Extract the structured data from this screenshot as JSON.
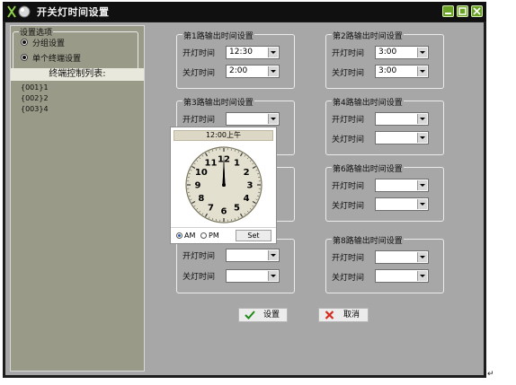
{
  "window": {
    "title": "开关灯时间设置"
  },
  "options": {
    "legend": "设置选项",
    "items": [
      {
        "label": "分组设置",
        "selected": true
      },
      {
        "label": "单个终端设置",
        "selected": true
      }
    ]
  },
  "terminal_list": {
    "header": "终端控制列表:",
    "items": [
      "{001}1",
      "{002}2",
      "{003}4"
    ]
  },
  "output_groups": [
    {
      "title": "第1路输出时间设置",
      "on_label": "开灯时间",
      "on_value": "12:30",
      "off_label": "关灯时间",
      "off_value": "2:00"
    },
    {
      "title": "第2路输出时间设置",
      "on_label": "开灯时间",
      "on_value": "3:00",
      "off_label": "关灯时间",
      "off_value": "3:00"
    },
    {
      "title": "第3路输出时间设置",
      "on_label": "开灯时间",
      "on_value": "",
      "off_label": "",
      "off_value": ""
    },
    {
      "title": "第4路输出时间设置",
      "on_label": "开灯时间",
      "on_value": "",
      "off_label": "关灯时间",
      "off_value": ""
    },
    {
      "title": "",
      "on_label": "",
      "on_value": "",
      "off_label": "",
      "off_value": ""
    },
    {
      "title": "第6路输出时间设置",
      "on_label": "开灯时间",
      "on_value": "",
      "off_label": "关灯时间",
      "off_value": ""
    },
    {
      "title": "",
      "on_label": "开灯时间",
      "on_value": "",
      "off_label": "关灯时间",
      "off_value": ""
    },
    {
      "title": "第8路输出时间设置",
      "on_label": "开灯时间",
      "on_value": "",
      "off_label": "关灯时间",
      "off_value": ""
    }
  ],
  "clock_picker": {
    "header": "12:00上午",
    "numbers": [
      "12",
      "1",
      "2",
      "3",
      "4",
      "5",
      "6",
      "7",
      "8",
      "9",
      "10",
      "11"
    ],
    "am_label": "AM",
    "pm_label": "PM",
    "am_selected": true,
    "set_label": "Set"
  },
  "buttons": {
    "ok_label": "设置",
    "cancel_label": "取消"
  },
  "colors": {
    "title_bg": "#101010",
    "body_bg": "#a7a7a7",
    "list_bg": "#9a9a88",
    "accent_green": "#6aa326"
  },
  "icons": {
    "ok": "checkmark-icon",
    "cancel": "x-icon",
    "title": "app-logo-icon"
  },
  "corner_glyph": "↵"
}
